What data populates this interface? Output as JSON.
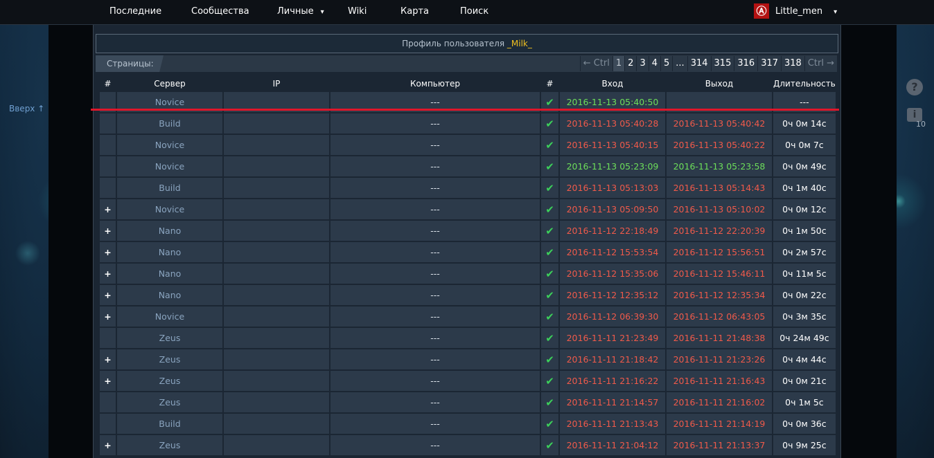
{
  "nav": {
    "items": [
      "Последние",
      "Сообщества",
      "Личные",
      "Wiki",
      "Карта",
      "Поиск"
    ],
    "user": "Little_men",
    "dropdown_glyph": "▾",
    "avatar_glyph": "Ⓐ"
  },
  "side": {
    "up_link": "Вверх ↑",
    "help_glyph": "?",
    "info_glyph": "i",
    "info_count": "10"
  },
  "profile": {
    "label": "Профиль пользователя",
    "username": "_Milk_"
  },
  "pages": {
    "label": "Страницы:",
    "prev": "← Ctrl",
    "next": "Ctrl →",
    "items": [
      "1",
      "2",
      "3",
      "4",
      "5",
      "...",
      "314",
      "315",
      "316",
      "317",
      "318"
    ],
    "current": "1"
  },
  "table": {
    "headers": [
      "#",
      "Сервер",
      "IP",
      "Компьютер",
      "#",
      "Вход",
      "Выход",
      "Длительность"
    ],
    "rows": [
      {
        "n": "",
        "server": "Novice",
        "ip": "",
        "pc": "---",
        "in": "2016-11-13 05:40:50",
        "in_c": "green",
        "out": "",
        "out_c": "green",
        "dur": "---"
      },
      {
        "n": "",
        "server": "Build",
        "ip": "",
        "pc": "---",
        "in": "2016-11-13 05:40:28",
        "in_c": "red",
        "out": "2016-11-13 05:40:42",
        "out_c": "red",
        "dur": "0ч 0м 14с"
      },
      {
        "n": "",
        "server": "Novice",
        "ip": "",
        "pc": "---",
        "in": "2016-11-13 05:40:15",
        "in_c": "red",
        "out": "2016-11-13 05:40:22",
        "out_c": "red",
        "dur": "0ч 0м 7с"
      },
      {
        "n": "",
        "server": "Novice",
        "ip": "",
        "pc": "---",
        "in": "2016-11-13 05:23:09",
        "in_c": "green",
        "out": "2016-11-13 05:23:58",
        "out_c": "green",
        "dur": "0ч 0м 49с"
      },
      {
        "n": "",
        "server": "Build",
        "ip": "",
        "pc": "---",
        "in": "2016-11-13 05:13:03",
        "in_c": "red",
        "out": "2016-11-13 05:14:43",
        "out_c": "red",
        "dur": "0ч 1м 40с"
      },
      {
        "n": "+",
        "server": "Novice",
        "ip": "",
        "pc": "---",
        "in": "2016-11-13 05:09:50",
        "in_c": "red",
        "out": "2016-11-13 05:10:02",
        "out_c": "red",
        "dur": "0ч 0м 12с"
      },
      {
        "n": "+",
        "server": "Nano",
        "ip": "",
        "pc": "---",
        "in": "2016-11-12 22:18:49",
        "in_c": "red",
        "out": "2016-11-12 22:20:39",
        "out_c": "red",
        "dur": "0ч 1м 50с"
      },
      {
        "n": "+",
        "server": "Nano",
        "ip": "",
        "pc": "---",
        "in": "2016-11-12 15:53:54",
        "in_c": "red",
        "out": "2016-11-12 15:56:51",
        "out_c": "red",
        "dur": "0ч 2м 57с"
      },
      {
        "n": "+",
        "server": "Nano",
        "ip": "",
        "pc": "---",
        "in": "2016-11-12 15:35:06",
        "in_c": "red",
        "out": "2016-11-12 15:46:11",
        "out_c": "red",
        "dur": "0ч 11м 5с"
      },
      {
        "n": "+",
        "server": "Nano",
        "ip": "",
        "pc": "---",
        "in": "2016-11-12 12:35:12",
        "in_c": "red",
        "out": "2016-11-12 12:35:34",
        "out_c": "red",
        "dur": "0ч 0м 22с"
      },
      {
        "n": "+",
        "server": "Novice",
        "ip": "",
        "pc": "---",
        "in": "2016-11-12 06:39:30",
        "in_c": "red",
        "out": "2016-11-12 06:43:05",
        "out_c": "red",
        "dur": "0ч 3м 35с"
      },
      {
        "n": "",
        "server": "Zeus",
        "ip": "",
        "pc": "---",
        "in": "2016-11-11 21:23:49",
        "in_c": "red",
        "out": "2016-11-11 21:48:38",
        "out_c": "red",
        "dur": "0ч 24м 49с"
      },
      {
        "n": "+",
        "server": "Zeus",
        "ip": "",
        "pc": "---",
        "in": "2016-11-11 21:18:42",
        "in_c": "red",
        "out": "2016-11-11 21:23:26",
        "out_c": "red",
        "dur": "0ч 4м 44с"
      },
      {
        "n": "+",
        "server": "Zeus",
        "ip": "",
        "pc": "---",
        "in": "2016-11-11 21:16:22",
        "in_c": "red",
        "out": "2016-11-11 21:16:43",
        "out_c": "red",
        "dur": "0ч 0м 21с"
      },
      {
        "n": "",
        "server": "Zeus",
        "ip": "",
        "pc": "---",
        "in": "2016-11-11 21:14:57",
        "in_c": "red",
        "out": "2016-11-11 21:16:02",
        "out_c": "red",
        "dur": "0ч 1м 5с"
      },
      {
        "n": "",
        "server": "Build",
        "ip": "",
        "pc": "---",
        "in": "2016-11-11 21:13:43",
        "in_c": "red",
        "out": "2016-11-11 21:14:19",
        "out_c": "red",
        "dur": "0ч 0м 36с"
      },
      {
        "n": "+",
        "server": "Zeus",
        "ip": "",
        "pc": "---",
        "in": "2016-11-11 21:04:12",
        "in_c": "red",
        "out": "2016-11-11 21:13:37",
        "out_c": "red",
        "dur": "0ч 9м 25с"
      }
    ]
  },
  "colors": {
    "accent_username": "#f0c020",
    "login_ok": "#6dde5a",
    "login_fail": "#f05a4a",
    "check": "#3cd05a",
    "highlight_line": "#e0162a"
  },
  "icons": {
    "check": "check-icon",
    "avatar": "anarchy-avatar-icon",
    "help": "help-icon",
    "info": "info-icon"
  }
}
